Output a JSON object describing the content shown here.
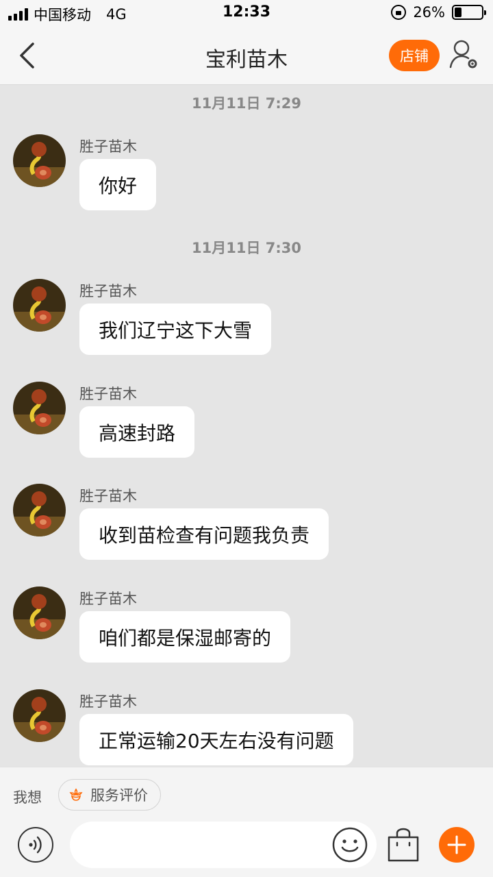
{
  "status_bar": {
    "carrier": "中国移动",
    "network": "4G",
    "time": "12:33",
    "battery_percent": "26%",
    "battery_level": 0.26
  },
  "nav": {
    "title": "宝利苗木",
    "shop_label": "店铺",
    "accent_color": "#ff6b08"
  },
  "messages": [
    {
      "timestamp": "11月11日 7:29"
    },
    {
      "sender": "胜子苗木",
      "text": "你好"
    },
    {
      "timestamp": "11月11日 7:30"
    },
    {
      "sender": "胜子苗木",
      "text": "我们辽宁这下大雪"
    },
    {
      "sender": "胜子苗木",
      "text": "高速封路"
    },
    {
      "sender": "胜子苗木",
      "text": "收到苗检查有问题我负责"
    },
    {
      "sender": "胜子苗木",
      "text": "咱们都是保湿邮寄的"
    },
    {
      "sender": "胜子苗木",
      "text": "正常运输20天左右没有问题"
    }
  ],
  "bottom": {
    "want_label": "我想",
    "service_label": "服务评价",
    "input_value": "",
    "icons": [
      "voice-icon",
      "emoji-icon",
      "shopping-bag-icon",
      "plus-icon",
      "flower-icon"
    ]
  }
}
